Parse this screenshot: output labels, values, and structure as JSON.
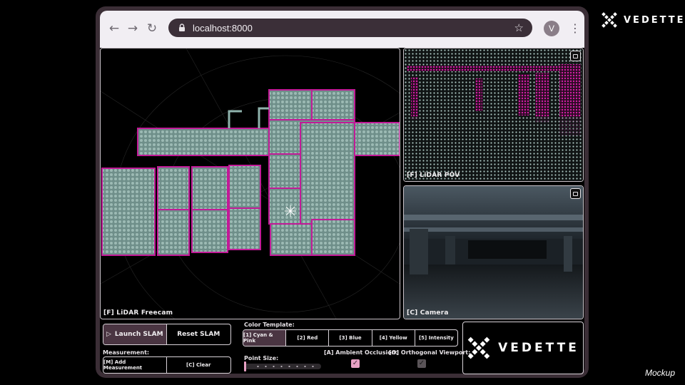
{
  "branding": {
    "wordmark": "VEDETTE"
  },
  "footer": {
    "mockup": "Mockup"
  },
  "browser": {
    "url": "localhost:8000",
    "avatar_initial": "V",
    "nav": {
      "back": "←",
      "forward": "→",
      "reload": "↻"
    },
    "star": "☆",
    "menu": "⋮"
  },
  "views": {
    "freecam_label": "[F] LiDAR Freecam",
    "pov_label": "[F] LiDAR POV",
    "camera_label": "[C] Camera"
  },
  "controls": {
    "launch_slam": "Launch SLAM",
    "reset_slam": "Reset SLAM",
    "measurement_label": "Measurement:",
    "add_measurement": "[M] Add Measurement",
    "clear": "[C] Clear",
    "color_template_label": "Color Template:",
    "color_templates": [
      "[1] Cyan & Pink",
      "[2] Red",
      "[3] Blue",
      "[4] Yellow",
      "[5] Intensity"
    ],
    "selected_color_template": "[1] Cyan & Pink",
    "point_size_label": "Point Size:",
    "point_size_level": 0.0,
    "ambient_occlusion_label": "[A] Ambient Occlusion:",
    "ambient_occlusion_checked": true,
    "orthogonal_label": "[O] Orthogonal Viewport:",
    "orthogonal_checked": true
  },
  "colors": {
    "cyan_points": "#8fb3ad",
    "pink_points": "#d21ea6",
    "accent_pink": "#e8a1c4",
    "frame": "#3b2e36"
  }
}
